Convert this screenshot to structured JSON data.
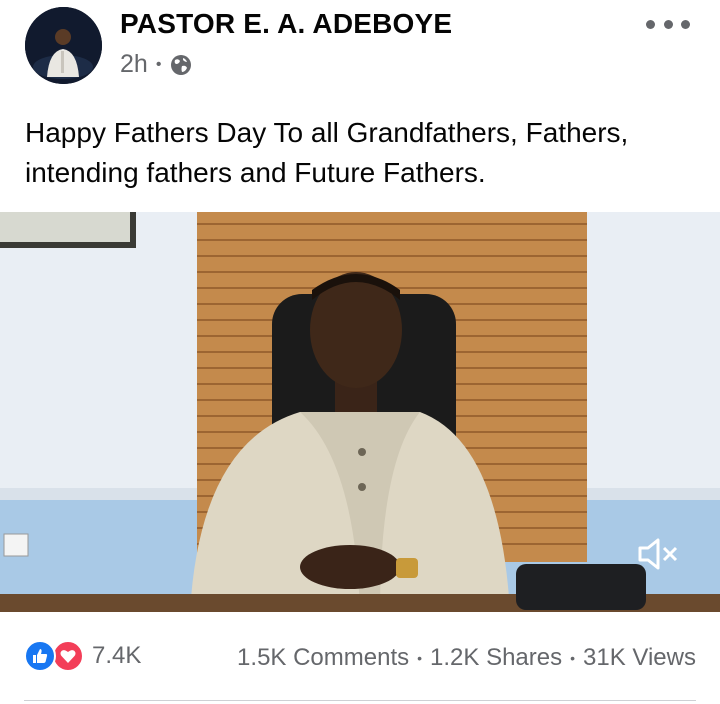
{
  "post": {
    "author": "PASTOR E. A. ADEBOYE",
    "time": "2h",
    "meta_separator": "•",
    "privacy_icon": "globe-icon",
    "text": "Happy Fathers Day To all Grandfathers, Fathers, intending fathers and Future Fathers."
  },
  "video": {
    "mute_icon": "speaker-muted-icon"
  },
  "stats": {
    "reaction_icons": [
      "like-icon",
      "love-icon"
    ],
    "reactions": "7.4K",
    "comments": "1.5K Comments",
    "shares": "1.2K Shares",
    "views": "31K Views",
    "separator": "•"
  },
  "colors": {
    "like": "#1877f2",
    "love": "#f33e58",
    "secondary_text": "#65676b"
  }
}
